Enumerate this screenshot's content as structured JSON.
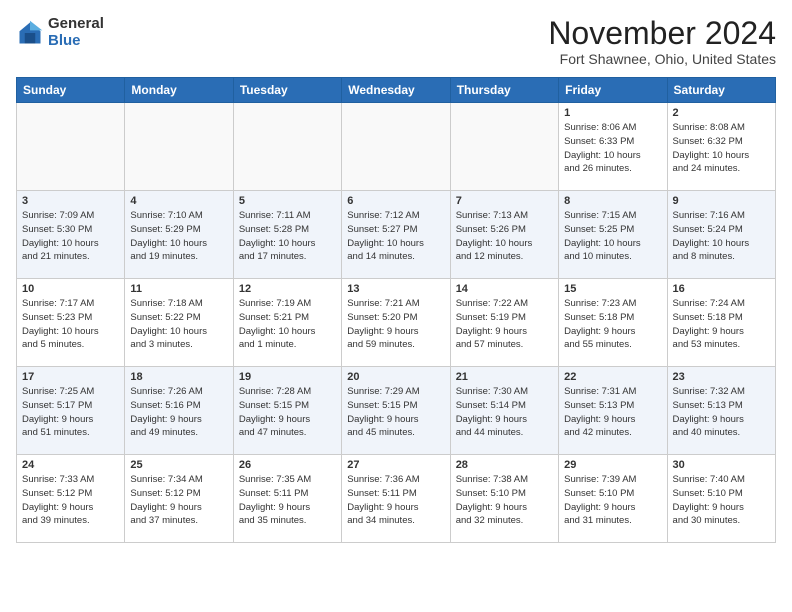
{
  "logo": {
    "general": "General",
    "blue": "Blue"
  },
  "header": {
    "month": "November 2024",
    "location": "Fort Shawnee, Ohio, United States"
  },
  "weekdays": [
    "Sunday",
    "Monday",
    "Tuesday",
    "Wednesday",
    "Thursday",
    "Friday",
    "Saturday"
  ],
  "weeks": [
    [
      {
        "day": "",
        "info": ""
      },
      {
        "day": "",
        "info": ""
      },
      {
        "day": "",
        "info": ""
      },
      {
        "day": "",
        "info": ""
      },
      {
        "day": "",
        "info": ""
      },
      {
        "day": "1",
        "info": "Sunrise: 8:06 AM\nSunset: 6:33 PM\nDaylight: 10 hours\nand 26 minutes."
      },
      {
        "day": "2",
        "info": "Sunrise: 8:08 AM\nSunset: 6:32 PM\nDaylight: 10 hours\nand 24 minutes."
      }
    ],
    [
      {
        "day": "3",
        "info": "Sunrise: 7:09 AM\nSunset: 5:30 PM\nDaylight: 10 hours\nand 21 minutes."
      },
      {
        "day": "4",
        "info": "Sunrise: 7:10 AM\nSunset: 5:29 PM\nDaylight: 10 hours\nand 19 minutes."
      },
      {
        "day": "5",
        "info": "Sunrise: 7:11 AM\nSunset: 5:28 PM\nDaylight: 10 hours\nand 17 minutes."
      },
      {
        "day": "6",
        "info": "Sunrise: 7:12 AM\nSunset: 5:27 PM\nDaylight: 10 hours\nand 14 minutes."
      },
      {
        "day": "7",
        "info": "Sunrise: 7:13 AM\nSunset: 5:26 PM\nDaylight: 10 hours\nand 12 minutes."
      },
      {
        "day": "8",
        "info": "Sunrise: 7:15 AM\nSunset: 5:25 PM\nDaylight: 10 hours\nand 10 minutes."
      },
      {
        "day": "9",
        "info": "Sunrise: 7:16 AM\nSunset: 5:24 PM\nDaylight: 10 hours\nand 8 minutes."
      }
    ],
    [
      {
        "day": "10",
        "info": "Sunrise: 7:17 AM\nSunset: 5:23 PM\nDaylight: 10 hours\nand 5 minutes."
      },
      {
        "day": "11",
        "info": "Sunrise: 7:18 AM\nSunset: 5:22 PM\nDaylight: 10 hours\nand 3 minutes."
      },
      {
        "day": "12",
        "info": "Sunrise: 7:19 AM\nSunset: 5:21 PM\nDaylight: 10 hours\nand 1 minute."
      },
      {
        "day": "13",
        "info": "Sunrise: 7:21 AM\nSunset: 5:20 PM\nDaylight: 9 hours\nand 59 minutes."
      },
      {
        "day": "14",
        "info": "Sunrise: 7:22 AM\nSunset: 5:19 PM\nDaylight: 9 hours\nand 57 minutes."
      },
      {
        "day": "15",
        "info": "Sunrise: 7:23 AM\nSunset: 5:18 PM\nDaylight: 9 hours\nand 55 minutes."
      },
      {
        "day": "16",
        "info": "Sunrise: 7:24 AM\nSunset: 5:18 PM\nDaylight: 9 hours\nand 53 minutes."
      }
    ],
    [
      {
        "day": "17",
        "info": "Sunrise: 7:25 AM\nSunset: 5:17 PM\nDaylight: 9 hours\nand 51 minutes."
      },
      {
        "day": "18",
        "info": "Sunrise: 7:26 AM\nSunset: 5:16 PM\nDaylight: 9 hours\nand 49 minutes."
      },
      {
        "day": "19",
        "info": "Sunrise: 7:28 AM\nSunset: 5:15 PM\nDaylight: 9 hours\nand 47 minutes."
      },
      {
        "day": "20",
        "info": "Sunrise: 7:29 AM\nSunset: 5:15 PM\nDaylight: 9 hours\nand 45 minutes."
      },
      {
        "day": "21",
        "info": "Sunrise: 7:30 AM\nSunset: 5:14 PM\nDaylight: 9 hours\nand 44 minutes."
      },
      {
        "day": "22",
        "info": "Sunrise: 7:31 AM\nSunset: 5:13 PM\nDaylight: 9 hours\nand 42 minutes."
      },
      {
        "day": "23",
        "info": "Sunrise: 7:32 AM\nSunset: 5:13 PM\nDaylight: 9 hours\nand 40 minutes."
      }
    ],
    [
      {
        "day": "24",
        "info": "Sunrise: 7:33 AM\nSunset: 5:12 PM\nDaylight: 9 hours\nand 39 minutes."
      },
      {
        "day": "25",
        "info": "Sunrise: 7:34 AM\nSunset: 5:12 PM\nDaylight: 9 hours\nand 37 minutes."
      },
      {
        "day": "26",
        "info": "Sunrise: 7:35 AM\nSunset: 5:11 PM\nDaylight: 9 hours\nand 35 minutes."
      },
      {
        "day": "27",
        "info": "Sunrise: 7:36 AM\nSunset: 5:11 PM\nDaylight: 9 hours\nand 34 minutes."
      },
      {
        "day": "28",
        "info": "Sunrise: 7:38 AM\nSunset: 5:10 PM\nDaylight: 9 hours\nand 32 minutes."
      },
      {
        "day": "29",
        "info": "Sunrise: 7:39 AM\nSunset: 5:10 PM\nDaylight: 9 hours\nand 31 minutes."
      },
      {
        "day": "30",
        "info": "Sunrise: 7:40 AM\nSunset: 5:10 PM\nDaylight: 9 hours\nand 30 minutes."
      }
    ]
  ]
}
